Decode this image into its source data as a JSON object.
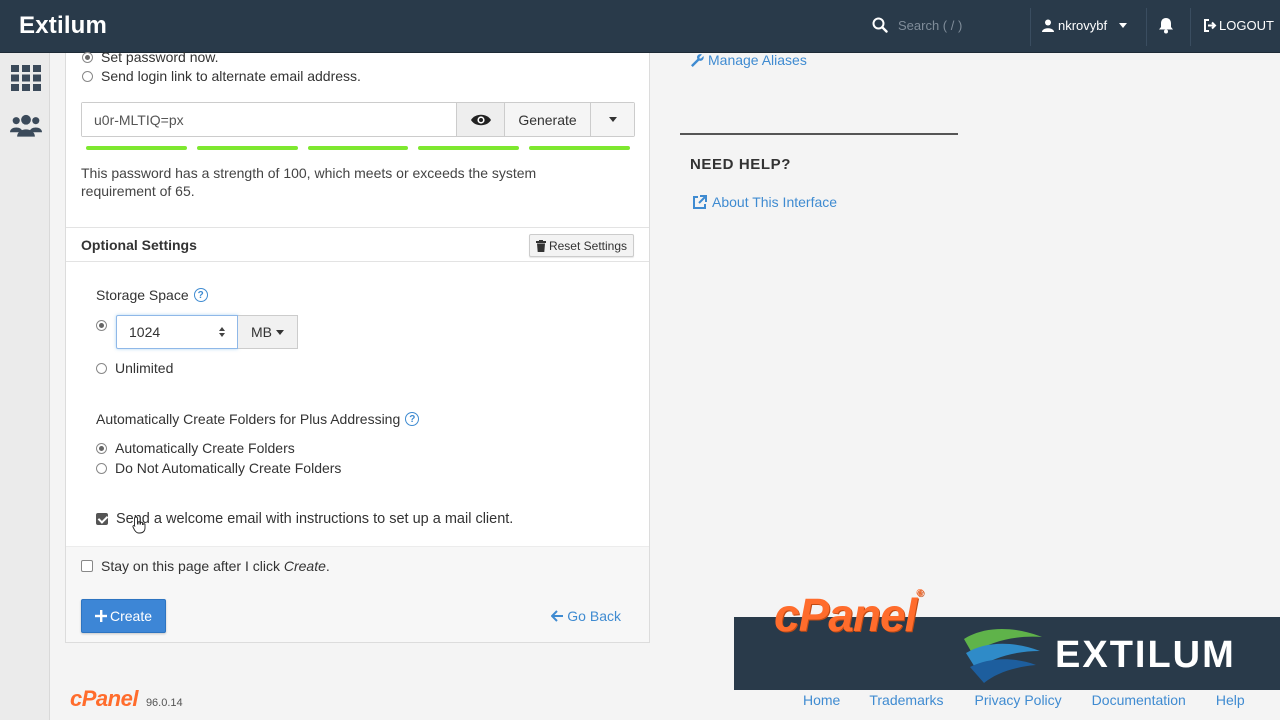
{
  "header": {
    "brand": "Extilum",
    "search_placeholder": "Search ( / )",
    "username": "nkrovybf",
    "logout_label": "LOGOUT"
  },
  "password": {
    "option_set_now": "Set password now.",
    "option_send_link": "Send login link to alternate email address.",
    "value": "u0r-MLTIQ=px",
    "generate_label": "Generate",
    "strength_message": "This password has a strength of 100, which meets or exceeds the system requirement of 65."
  },
  "optional": {
    "title": "Optional Settings",
    "reset_label": "Reset Settings",
    "storage_label": "Storage Space",
    "storage_value": "1024",
    "storage_unit": "MB",
    "unlimited_label": "Unlimited",
    "folders_label": "Automatically Create Folders for Plus Addressing",
    "folders_auto": "Automatically Create Folders",
    "folders_no": "Do Not Automatically Create Folders",
    "welcome_label": "Send a welcome email with instructions to set up a mail client."
  },
  "footer_form": {
    "stay_label": "Stay on this page after I click",
    "stay_emph": "Create",
    "stay_end": ".",
    "create_label": "Create",
    "go_back_label": "Go Back"
  },
  "right": {
    "manage_aliases": "Manage Aliases",
    "need_help": "NEED HELP?",
    "about_interface": "About This Interface"
  },
  "bottom": {
    "cpanel_logo": "cPanel",
    "version": "96.0.14",
    "overlay_cpanel": "cPanel",
    "overlay_reg": "®",
    "overlay_brand": "EXTILUM",
    "links": [
      "Home",
      "Trademarks",
      "Privacy Policy",
      "Documentation",
      "Help"
    ]
  },
  "colors": {
    "header_bg": "#293a4a",
    "link": "#3f8bd1",
    "primary": "#3d86d6",
    "strength": "#7ee82f",
    "cpanel_orange": "#ff6c2c"
  }
}
